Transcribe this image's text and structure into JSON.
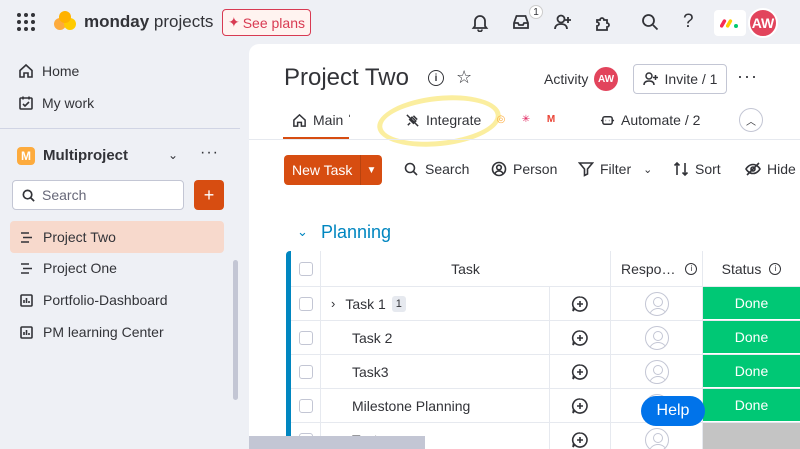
{
  "topbar": {
    "brand_bold": "monday",
    "brand_rest": " projects",
    "see_plans": "See plans",
    "inbox_count": "1",
    "avatar_initials": "AW",
    "help": "?"
  },
  "sidebar": {
    "home": "Home",
    "my_work": "My work",
    "workspace_letter": "M",
    "workspace_name": "Multiproject",
    "search_placeholder": "Search",
    "add": "+",
    "boards": [
      {
        "label": "Project Two",
        "active": true
      },
      {
        "label": "Project One",
        "active": false
      },
      {
        "label": "Portfolio-Dashboard",
        "active": false
      },
      {
        "label": "PM learning Center",
        "active": false
      }
    ]
  },
  "board": {
    "title": "Project Two",
    "activity": "Activity",
    "activity_avatar": "AW",
    "invite": "Invite / 1",
    "tabs": {
      "main": "Main ˈ",
      "integrate": "Integrate",
      "automate": "Automate / 2"
    },
    "toolbar": {
      "new_task": "New Task",
      "search": "Search",
      "person": "Person",
      "filter": "Filter",
      "sort": "Sort",
      "hide": "Hide"
    },
    "group": {
      "title": "Planning",
      "color": "#0086c0",
      "columns": {
        "task": "Task",
        "responsible": "Respo…",
        "status": "Status"
      },
      "rows": [
        {
          "name": "Task 1",
          "subitems": "1",
          "status": "Done"
        },
        {
          "name": "Task 2",
          "subitems": "",
          "status": "Done"
        },
        {
          "name": "Task3",
          "subitems": "",
          "status": "Done"
        },
        {
          "name": "Milestone Planning",
          "subitems": "",
          "status": "Done"
        },
        {
          "name": "Test",
          "subitems": "",
          "status": ""
        }
      ]
    }
  },
  "help_button": "Help",
  "colors": {
    "accent": "#d74d11",
    "done": "#00c875",
    "group": "#0086c0",
    "help": "#0073ea"
  }
}
